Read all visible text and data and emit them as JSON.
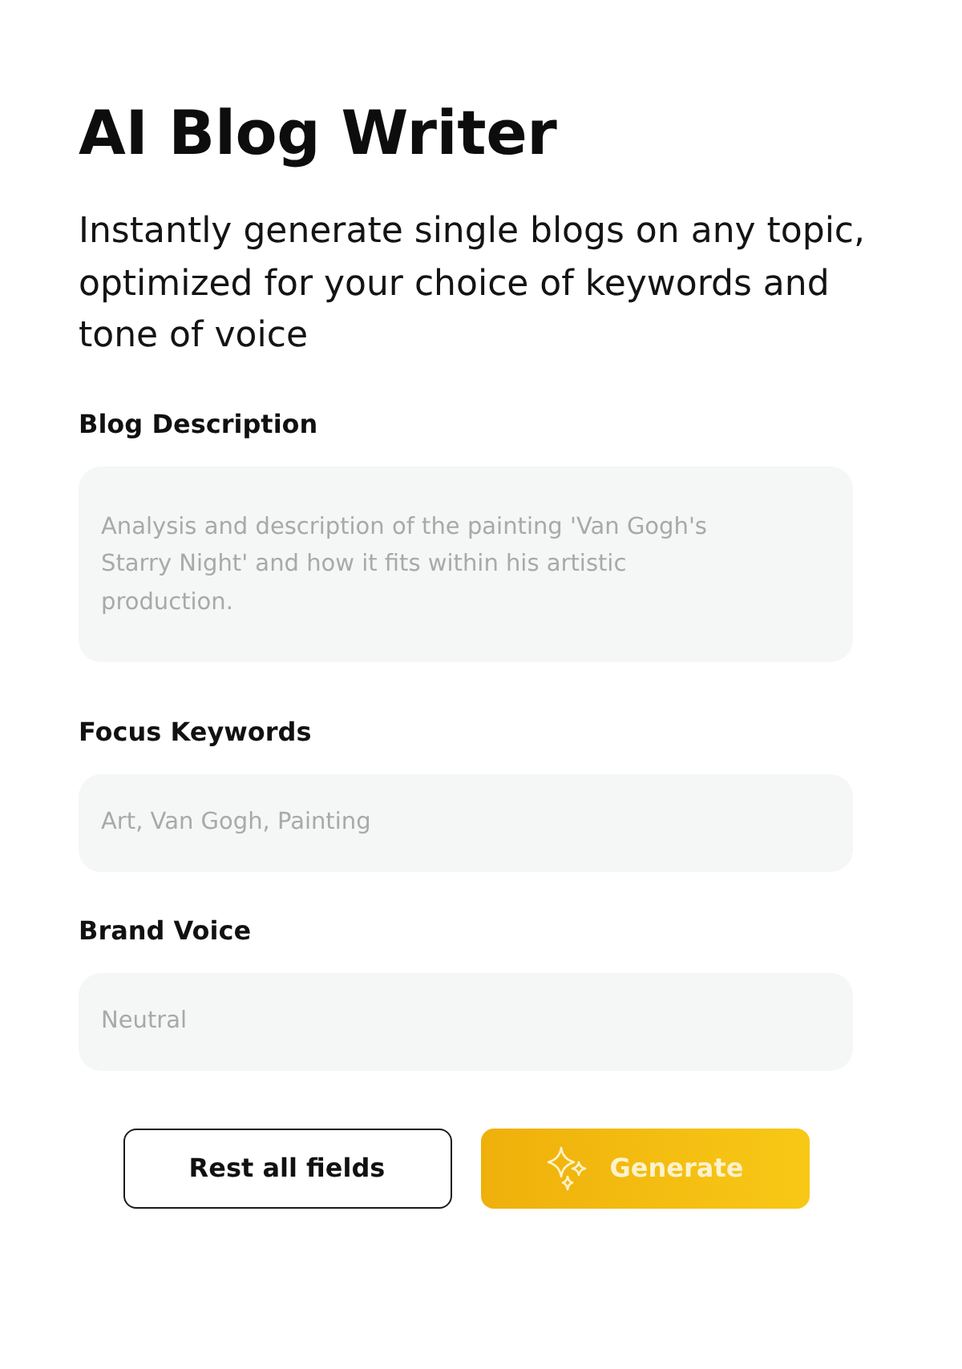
{
  "title": "AI Blog Writer",
  "subtitle": "Instantly generate single blogs on any topic, optimized for your choice of keywords and tone of voice",
  "fields": [
    {
      "kind": "textarea",
      "label": "Blog Description",
      "placeholder": "Analysis and description of the painting 'Van Gogh's Starry Night' and how it fits within his artistic production."
    },
    {
      "kind": "input",
      "label": "Focus Keywords",
      "placeholder": "Art, Van Gogh, Painting"
    },
    {
      "kind": "input",
      "label": "Brand Voice",
      "placeholder": "Neutral"
    }
  ],
  "buttons": [
    {
      "kind": "outline",
      "label": "Rest all fields"
    },
    {
      "kind": "primary",
      "label": "Generate"
    }
  ]
}
